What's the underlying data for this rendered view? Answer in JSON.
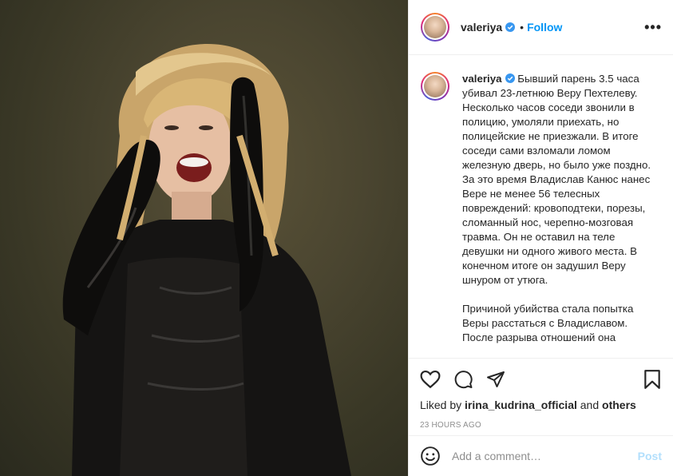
{
  "post": {
    "username": "valeriya",
    "dot": "•",
    "follow_label": "Follow",
    "more_label": "•••",
    "caption_paragraphs": [
      "Бывший парень 3.5 часа убивал 23-летнюю Веру Пехтелеву. Несколько часов соседи звонили в полицию, умоляли приехать, но полицейские не приезжали. В итоге соседи сами взломали ломом железную дверь, но было уже поздно. За это время Владислав Канюс нанес Вере не менее 56 телесных повреждений: кровоподтеки, порезы, сломанный нос, черепно-мозговая травма. Он не оставил на теле девушки ни одного живого места. В конечном итоге он задушил Веру шнуром от утюга.",
      "Причиной убийства стала попытка Веры расстаться с Владиславом. После разрыва отношений она"
    ],
    "liked_prefix": "Liked by",
    "liked_user": "irina_kudrina_official",
    "liked_and": "and",
    "liked_others": "others",
    "timestamp": "23 HOURS AGO",
    "comment_placeholder": "Add a comment…",
    "post_label": "Post"
  },
  "icons": {
    "like": "heart-icon",
    "comment": "comment-icon",
    "share": "share-icon",
    "save": "bookmark-icon",
    "emoji": "emoji-icon",
    "verified": "verified-icon"
  },
  "colors": {
    "accent": "#0095f6",
    "post_disabled": "#b2dffc",
    "verified": "#3897f0",
    "muted": "#8e8e8e"
  }
}
